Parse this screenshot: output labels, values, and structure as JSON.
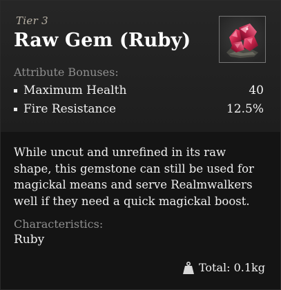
{
  "tooltip": {
    "tier": "Tier 3",
    "item_name": "Raw Gem (Ruby)",
    "icon": "ruby-gem-icon",
    "attributes_label": "Attribute Bonuses:",
    "attributes": [
      {
        "name": "Maximum Health",
        "value": "40"
      },
      {
        "name": "Fire Resistance",
        "value": "12.5%"
      }
    ],
    "description_lines": [
      "While uncut and unrefined in its raw",
      "shape, this gemstone can still be used for",
      "magickal means and serve Realmwalkers",
      "well if they need a quick magickal boost."
    ],
    "characteristics_label": "Characteristics:",
    "characteristic": "Ruby",
    "weight": "Total: 0.1kg",
    "weight_icon": "weight-icon"
  },
  "colors": {
    "panel_top": "#262626",
    "panel_bottom": "#141414",
    "label_gray": "#8f8f8f",
    "text_white": "#f2f2f2",
    "gem_red": "#c8234a"
  }
}
